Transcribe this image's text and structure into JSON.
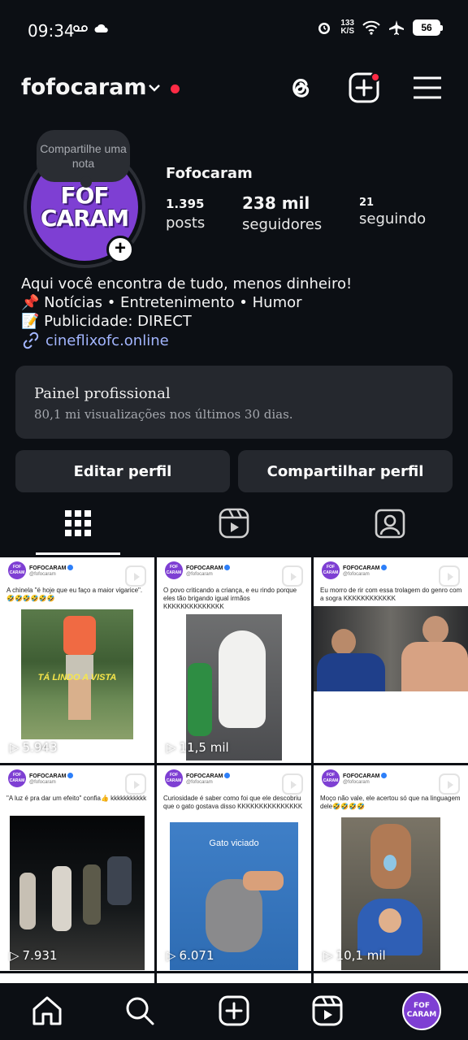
{
  "status_bar": {
    "time": "09:34",
    "speed_value": "133",
    "speed_unit": "K/S",
    "battery": "56"
  },
  "header": {
    "username": "fofocaram"
  },
  "profile": {
    "note_text": "Compartilhe uma nota",
    "avatar_line1": "FOF",
    "avatar_line2": "CARAM",
    "display_name": "Fofocaram",
    "posts_count": "1.395",
    "posts_label": "posts",
    "followers_count": "238 mil",
    "followers_label": "seguidores",
    "following_count": "21",
    "following_label": "seguindo",
    "bio_line1": "Aqui você encontra de tudo, menos dinheiro!",
    "bio_line2": "📌 Notícias • Entretenimento • Humor",
    "bio_line3": "📝 Publicidade: DIRECT",
    "link": "cineflixofc.online"
  },
  "pro_panel": {
    "title": "Painel profissional",
    "subtitle": "80,1 mi visualizações nos últimos 30 dias."
  },
  "buttons": {
    "edit": "Editar perfil",
    "share": "Compartilhar perfil"
  },
  "posts": [
    {
      "name": "FOFOCARAM",
      "handle": "@fofocaram",
      "caption": "A chinela \"é hoje que eu faço a maior vigarice\". 🤣🤣🤣🤣🤣🤣",
      "overlay": "TÁ LINDO A VISTA",
      "views": "5.943"
    },
    {
      "name": "FOFOCARAM",
      "handle": "@fofocaram",
      "caption": "O povo criticando a criança, e eu rindo porque eles tão brigando igual irmãos KKKKKKKKKKKKKK",
      "overlay": "",
      "views": "11,5 mil"
    },
    {
      "name": "FOFOCARAM",
      "handle": "@fofocaram",
      "caption": "Eu morro de rir com essa trolagem do genro com a sogra KKKKKKKKKKKK",
      "overlay": "",
      "views": ""
    },
    {
      "name": "FOFOCARAM",
      "handle": "@fofocaram",
      "caption": "\"A luz é pra dar um efeito\" confia👍 kkkkkkkkkkk",
      "overlay": "",
      "views": "7.931"
    },
    {
      "name": "FOFOCARAM",
      "handle": "@fofocaram",
      "caption": "Curiosidade é saber como foi que ele descobriu que o gato gostava disso KKKKKKKKKKKKKKK",
      "overlay": "Gato viciado",
      "views": "6.071"
    },
    {
      "name": "FOFOCARAM",
      "handle": "@fofocaram",
      "caption": "Moço não vale, ele acertou só que na linguagem dele🤣🤣🤣🤣",
      "overlay": "",
      "views": "10,1 mil"
    }
  ],
  "nav": {
    "avatar_line1": "FOF",
    "avatar_line2": "CARAM"
  },
  "colors": {
    "background": "#0c0f14",
    "panel": "#25282e",
    "accent_red": "#ff2b45",
    "link": "#a3b6ff",
    "brand_purple": "#7e3fd3"
  }
}
